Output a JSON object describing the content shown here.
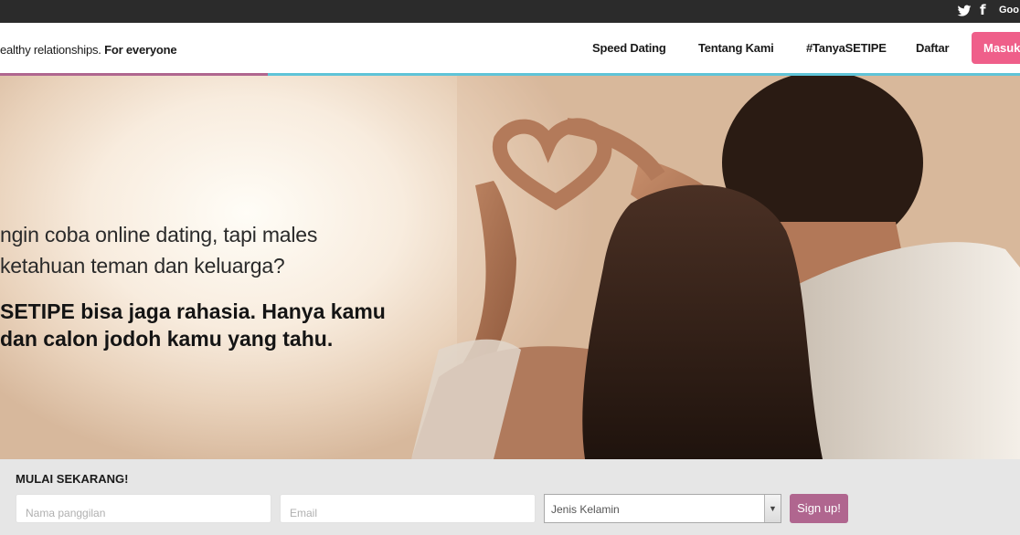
{
  "topbar": {
    "twitter_icon": "twitter-icon",
    "facebook_icon": "facebook-icon",
    "facebook_glyph": "f",
    "google_label": "Goo"
  },
  "header": {
    "tagline_normal": "ealthy relationships.",
    "tagline_bold": "For everyone",
    "nav": {
      "speed_dating": "Speed Dating",
      "tentang_kami": "Tentang Kami",
      "tanya_setipe": "#TanyaSETIPE",
      "daftar": "Daftar"
    },
    "masuk": "Masuk",
    "accent_colors": {
      "pink": "#b0668f",
      "blue": "#5fc4d8"
    }
  },
  "hero": {
    "question_line1": "ngin coba online dating, tapi males",
    "question_line2": "ketahuan teman dan keluarga?",
    "answer_line1": "SETIPE bisa jaga rahasia. Hanya kamu",
    "answer_line2": "dan calon jodoh kamu yang tahu."
  },
  "signup": {
    "title": "MULAI SEKARANG!",
    "nickname_placeholder": "Nama panggilan",
    "email_placeholder": "Email",
    "gender_select": "Jenis Kelamin",
    "submit": "Sign up!",
    "button_color": "#b0668f"
  },
  "colors": {
    "masuk_button": "#ef5f8a",
    "topbar_bg": "#2b2b2b",
    "signup_bg": "#e6e6e6"
  }
}
